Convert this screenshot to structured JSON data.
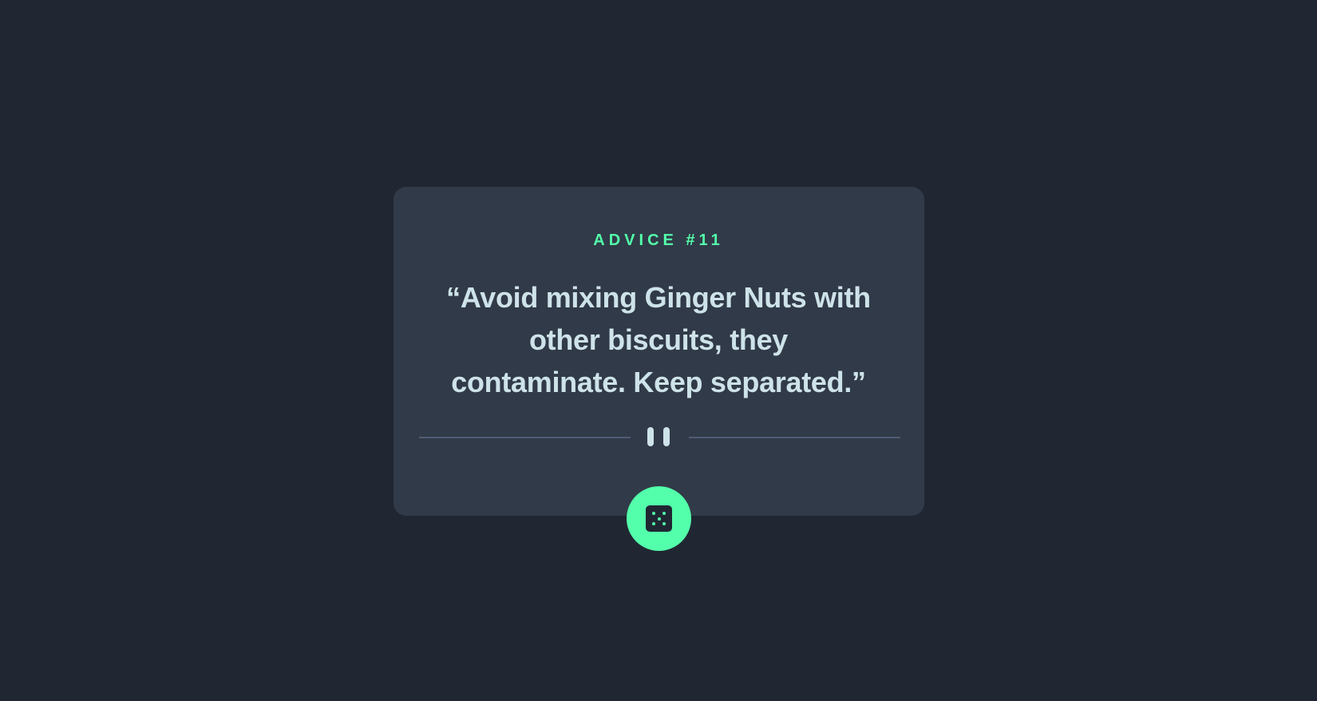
{
  "card": {
    "advice_label": "ADVICE #11",
    "quote_line_1": "“Avoid mixing Ginger Nuts with",
    "quote_line_2": "other biscuits, they",
    "quote_line_3": "contaminate. Keep separated.”"
  },
  "icons": {
    "divider": "pause-icon",
    "button": "dice-icon"
  },
  "colors": {
    "background": "#202733",
    "card": "#313a48",
    "accent": "#53ffaa",
    "text": "#cee3e9",
    "divider": "#4f5d74"
  }
}
